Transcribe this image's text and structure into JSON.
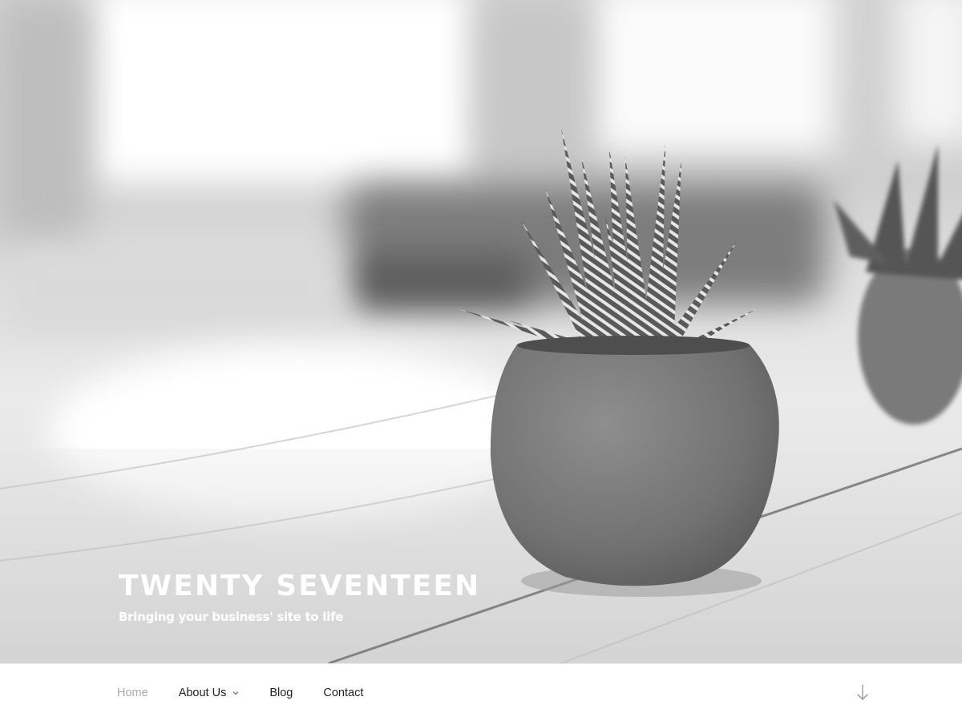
{
  "header": {
    "site_title": "TWENTY SEVENTEEN",
    "site_description": "Bringing your business' site to life",
    "hero_image": "succulent-plant-in-pot-on-wooden-table"
  },
  "navigation": {
    "items": [
      {
        "label": "Home",
        "current": true
      },
      {
        "label": "About Us",
        "has_submenu": true
      },
      {
        "label": "Blog"
      },
      {
        "label": "Contact"
      }
    ],
    "scroll_icon": "arrow-down-icon"
  },
  "colors": {
    "nav_text": "#222222",
    "nav_current": "#aaaaaa",
    "title_text": "#ffffff"
  }
}
